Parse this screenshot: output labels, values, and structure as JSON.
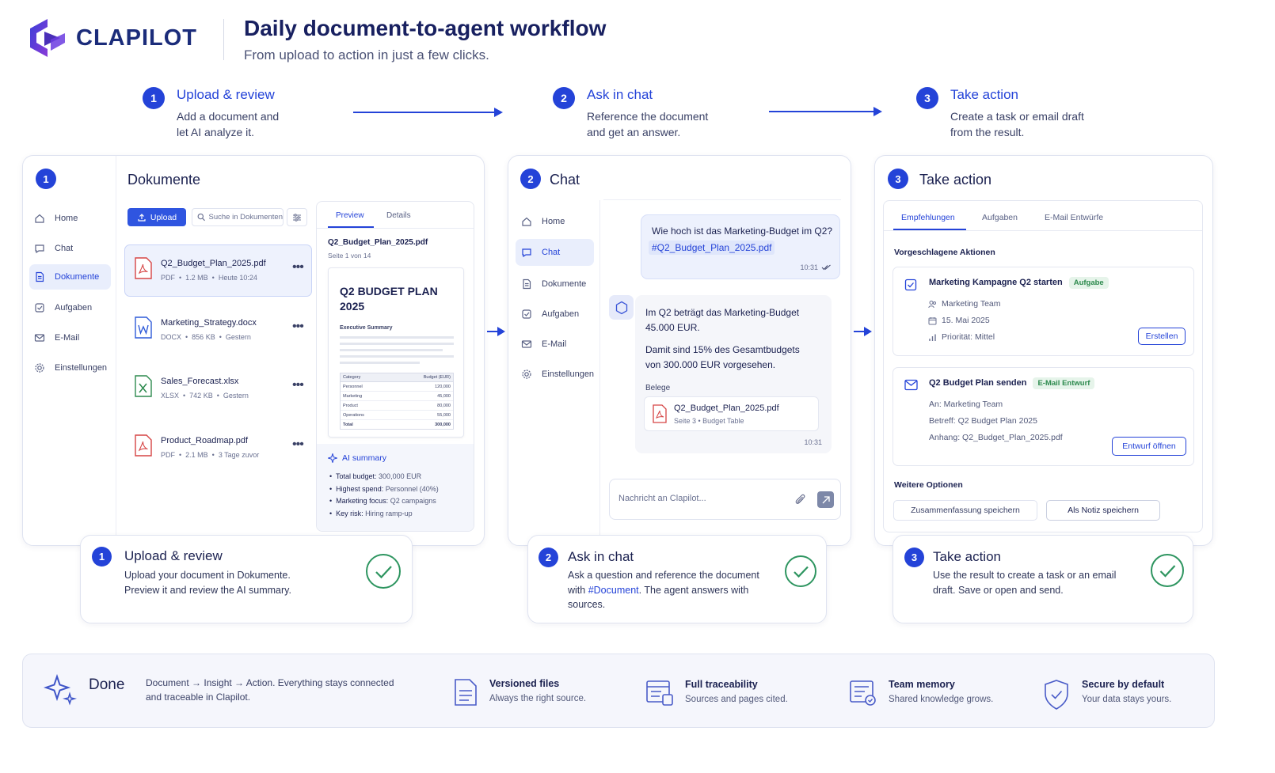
{
  "brand": {
    "name": "CLAPILOT"
  },
  "header": {
    "title": "Daily document-to-agent workflow",
    "subtitle": "From upload to action in just a few clicks."
  },
  "steps": [
    {
      "num": "1",
      "title": "Upload & review",
      "desc1": "Add a document and",
      "desc2": "let AI analyze it."
    },
    {
      "num": "2",
      "title": "Ask in chat",
      "desc1": "Reference the document",
      "desc2": "and get an answer."
    },
    {
      "num": "3",
      "title": "Take action",
      "desc1": "Create a task or email draft",
      "desc2": "from the result."
    }
  ],
  "panel1": {
    "num": "1",
    "nav": [
      "Home",
      "Chat",
      "Dokumente",
      "Aufgaben",
      "E-Mail",
      "Einstellungen"
    ],
    "title": "Dokumente",
    "upload_label": "Upload",
    "search_placeholder": "Suche in Dokumenten",
    "files": [
      {
        "name": "Q2_Budget_Plan_2025.pdf",
        "type": "PDF",
        "size": "1.2 MB",
        "date": "Heute 10:24",
        "icon": "pdf-icon"
      },
      {
        "name": "Marketing_Strategy.docx",
        "type": "DOCX",
        "size": "856 KB",
        "date": "Gestern",
        "icon": "word-icon"
      },
      {
        "name": "Sales_Forecast.xlsx",
        "type": "XLSX",
        "size": "742 KB",
        "date": "Gestern",
        "icon": "excel-icon"
      },
      {
        "name": "Product_Roadmap.pdf",
        "type": "PDF",
        "size": "2.1 MB",
        "date": "3 Tage zuvor",
        "icon": "pdf-icon"
      }
    ],
    "preview": {
      "tab_preview": "Preview",
      "tab_details": "Details",
      "file": "Q2_Budget_Plan_2025.pdf",
      "page": "Seite 1 von 14",
      "doc_title": "Q2 BUDGET PLAN 2025",
      "exec": "Executive Summary",
      "table_head": [
        "Category",
        "Budget (EUR)"
      ],
      "table_rows": [
        [
          "Personnel",
          "120,000"
        ],
        [
          "Marketing",
          "45,000"
        ],
        [
          "Product",
          "80,000"
        ],
        [
          "Operations",
          "55,000"
        ],
        [
          "Total",
          "300,000"
        ]
      ],
      "ai_title": "AI summary",
      "ai_items": [
        [
          "Total budget: ",
          "300,000 EUR"
        ],
        [
          "Highest spend: ",
          "Personnel (40%)"
        ],
        [
          "Marketing focus: ",
          "Q2 campaigns"
        ],
        [
          "Key risk: ",
          "Hiring ramp-up"
        ]
      ]
    }
  },
  "panel2": {
    "num": "2",
    "title": "Chat",
    "nav": [
      "Home",
      "Chat",
      "Dokumente",
      "Aufgaben",
      "E-Mail",
      "Einstellungen"
    ],
    "user_msg": "Wie hoch ist das Marketing-Budget im Q2?",
    "user_ref": "#Q2_Budget_Plan_2025.pdf",
    "user_time": "10:31",
    "bot_p1a": "Im Q2 beträgt das Marketing-Budget",
    "bot_p1b": "45.000 EUR.",
    "bot_p2a": "Damit sind 15% des Gesamtbudgets",
    "bot_p2b": "von 300.000 EUR vorgesehen.",
    "belege": "Belege",
    "source_file": "Q2_Budget_Plan_2025.pdf",
    "source_meta": "Seite 3 • Budget Table",
    "bot_time": "10:31",
    "input_placeholder": "Nachricht an Clapilot..."
  },
  "panel3": {
    "num": "3",
    "title": "Take action",
    "tabs": [
      "Empfehlungen",
      "Aufgaben",
      "E-Mail Entwürfe"
    ],
    "section": "Vorgeschlagene Aktionen",
    "a1": {
      "title": "Marketing Kampagne Q2 starten",
      "tag": "Aufgabe",
      "team": "Marketing Team",
      "date": "15. Mai 2025",
      "prio": "Priorität: Mittel",
      "btn": "Erstellen"
    },
    "a2": {
      "title": "Q2 Budget Plan senden",
      "tag": "E-Mail Entwurf",
      "to": "An: Marketing Team",
      "subject": "Betreff: Q2 Budget Plan 2025",
      "attach": "Anhang: Q2_Budget_Plan_2025.pdf",
      "btn": "Entwurf öffnen"
    },
    "more": "Weitere Optionen",
    "opt1": "Zusammenfassung speichern",
    "opt2": "Als Notiz speichern"
  },
  "summaries": [
    {
      "num": "1",
      "title": "Upload & review",
      "l1": "Upload your document in Dokumente.",
      "l2": "Preview it and review the AI summary.",
      "l3": ""
    },
    {
      "num": "2",
      "title": "Ask in chat",
      "l1": "Ask a question and reference the document",
      "l2pre": "with ",
      "l2hl": "#Document",
      "l2post": ". The agent answers with",
      "l3": "sources."
    },
    {
      "num": "3",
      "title": "Take action",
      "l1": "Use the result to create a task or an email",
      "l2": "draft. Save or open and send.",
      "l3": ""
    }
  ],
  "footer": {
    "done": "Done",
    "desc1": "Document → Insight → Action. Everything stays connected",
    "desc2": "and traceable in Clapilot.",
    "features": [
      {
        "title": "Versioned files",
        "desc": "Always the right source.",
        "icon": "document-icon"
      },
      {
        "title": "Full traceability",
        "desc": "Sources and pages cited.",
        "icon": "traceability-icon"
      },
      {
        "title": "Team memory",
        "desc": "Shared knowledge grows.",
        "icon": "team-memory-icon"
      },
      {
        "title": "Secure by default",
        "desc": "Your data stays yours.",
        "icon": "shield-icon"
      }
    ]
  },
  "colors": {
    "accent": "#2443d8",
    "success": "#2e9560",
    "text": "#1b2150"
  }
}
